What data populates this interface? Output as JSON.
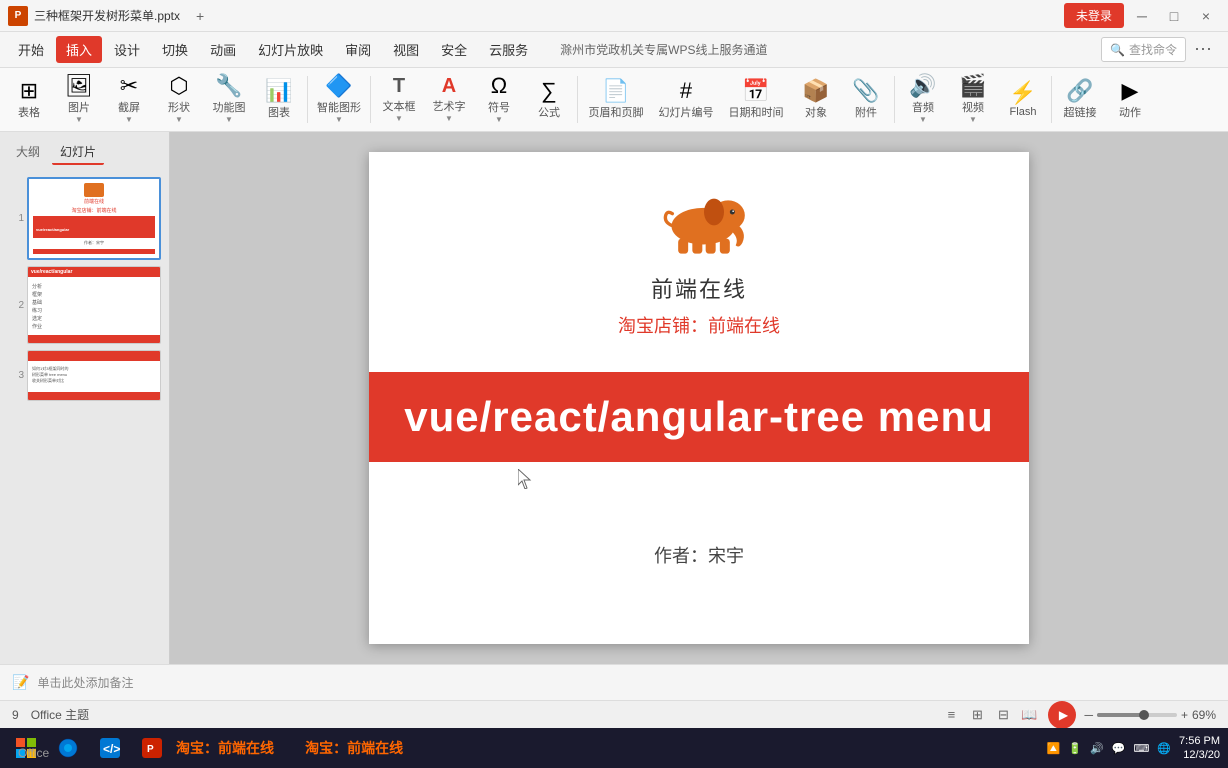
{
  "titlebar": {
    "doc_title": "三种框架开发树形菜单.pptx",
    "login_btn": "未登录",
    "close_label": "×",
    "min_label": "─",
    "max_label": "□"
  },
  "menubar": {
    "items": [
      "开始",
      "插入",
      "设计",
      "切换",
      "动画",
      "幻灯片放映",
      "审阅",
      "视图",
      "安全",
      "云服务"
    ],
    "active": "插入",
    "extra": "滁州市党政机关专属WPS线上服务通道"
  },
  "toolbar": {
    "groups": [
      {
        "label": "表格",
        "icon": "⊞"
      },
      {
        "label": "图片",
        "icon": "🖼"
      },
      {
        "label": "截屏",
        "icon": "✂"
      },
      {
        "label": "形状",
        "icon": "⬡"
      },
      {
        "label": "功能图",
        "icon": "🔧"
      },
      {
        "label": "图表",
        "icon": "📊"
      },
      {
        "label": "智能图形",
        "icon": "🔷"
      },
      {
        "label": "文本框",
        "icon": "T"
      },
      {
        "label": "艺术字",
        "icon": "A"
      },
      {
        "label": "符号",
        "icon": "Ω"
      },
      {
        "label": "公式",
        "icon": "∑"
      },
      {
        "label": "页眉和页脚",
        "icon": "📄"
      },
      {
        "label": "幻灯片编号",
        "icon": "#"
      },
      {
        "label": "日期和时间",
        "icon": "📅"
      },
      {
        "label": "对象",
        "icon": "📦"
      },
      {
        "label": "附件",
        "icon": "📎"
      },
      {
        "label": "音频",
        "icon": "🔊"
      },
      {
        "label": "视频",
        "icon": "🎬"
      },
      {
        "label": "Flash",
        "icon": "⚡"
      },
      {
        "label": "超链接",
        "icon": "🔗"
      },
      {
        "label": "动作",
        "icon": "▶"
      }
    ],
    "search_placeholder": "查找命令"
  },
  "panel": {
    "tabs": [
      "大纲",
      "幻灯片"
    ],
    "active_tab": "幻灯片",
    "slides": [
      {
        "num": "1",
        "type": "title"
      },
      {
        "num": "2",
        "type": "outline"
      },
      {
        "num": "3",
        "type": "content"
      }
    ]
  },
  "slide": {
    "logo_text": "前端在线",
    "site_name": "前端在线",
    "taobao_line": "淘宝店铺：前端在线",
    "main_title": "vue/react/angular-tree menu",
    "author_line": "作者：宋宇"
  },
  "notes_bar": {
    "placeholder": "单击此处添加备注"
  },
  "status_bar": {
    "slide_count": "9",
    "theme": "Office 主题",
    "zoom": "69%"
  },
  "taskbar": {
    "marquee": "淘宝：前端在线",
    "time": "7:56 PM",
    "date": "12/3/20",
    "office_label": "Office"
  }
}
